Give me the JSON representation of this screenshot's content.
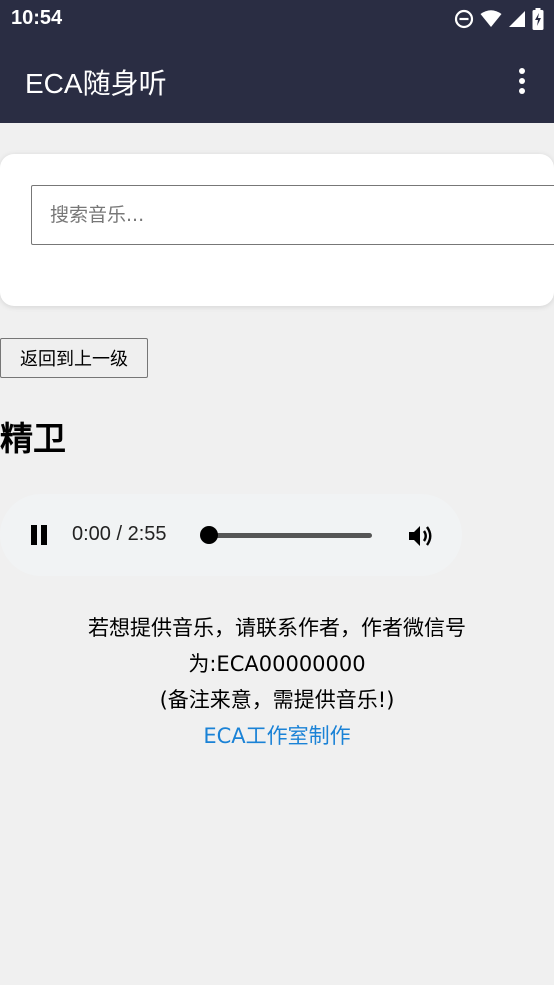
{
  "status_bar": {
    "time": "10:54",
    "icons": [
      "do-not-disturb-icon",
      "wifi-icon",
      "signal-icon",
      "battery-charging-icon"
    ]
  },
  "app_bar": {
    "title": "ECA随身听",
    "menu_icon": "more-vert-icon"
  },
  "search": {
    "placeholder": "搜索音乐..."
  },
  "back_button": {
    "label": "返回到上一级"
  },
  "song": {
    "title": "精卫"
  },
  "player": {
    "time": "0:00 / 2:55",
    "state_icon": "pause-icon",
    "progress": 0,
    "volume_icon": "volume-icon"
  },
  "info": {
    "line1": "若想提供音乐，请联系作者，作者微信号",
    "line2": "为:ECA00000000",
    "line3": "(备注来意，需提供音乐!)",
    "link": "ECA工作室制作"
  },
  "colors": {
    "bar": "#2a2d43",
    "background": "#f0f0f0",
    "link": "#1a82d6"
  }
}
